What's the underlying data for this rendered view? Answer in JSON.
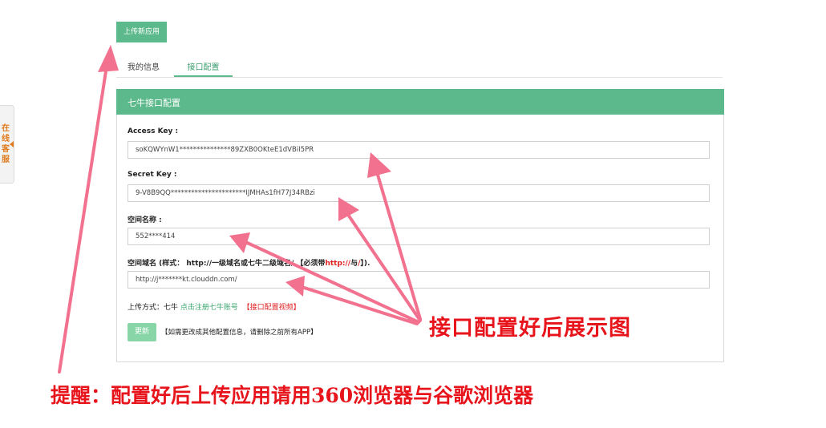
{
  "side_tab": {
    "label": "在线客服"
  },
  "upload_button": {
    "label": "上传新应用"
  },
  "tabs": [
    {
      "label": "我的信息",
      "active": false
    },
    {
      "label": "接口配置",
      "active": true
    }
  ],
  "panel": {
    "title": "七牛接口配置",
    "access_key": {
      "label": "Access Key :",
      "value": "soKQWYnW1***************89ZXB0OKteE1dVBiI5PR"
    },
    "secret_key": {
      "label": "Secret Key :",
      "value": "9-V8B9QQ**********************IJMHAs1fH77J34RBzi"
    },
    "space_name": {
      "label": "空间名称 :",
      "value": "552****414"
    },
    "space_domain": {
      "label_prefix": "空间域名 (样式： http://一级域名或七牛二级域名/ 【必须带",
      "label_highlight": "http://",
      "label_mid": "与",
      "label_highlight2": "/",
      "label_suffix": "】).",
      "value": "http://j*******kt.clouddn.com/"
    },
    "upload_method": {
      "label": "上传方式：七牛",
      "register_link": "点击注册七牛账号",
      "video_link": "【接口配置视频】"
    },
    "update_button": {
      "label": "更新"
    },
    "hint": "【如需更改成其他配置信息，请删除之前所有APP】"
  },
  "annotations": {
    "callout": "接口配置好后展示图",
    "reminder": "提醒：配置好后上传应用请用360浏览器与谷歌浏览器"
  },
  "colors": {
    "accent": "#5cb98b",
    "annotation_red": "#e8141c",
    "arrow_pink": "#f2718f"
  }
}
